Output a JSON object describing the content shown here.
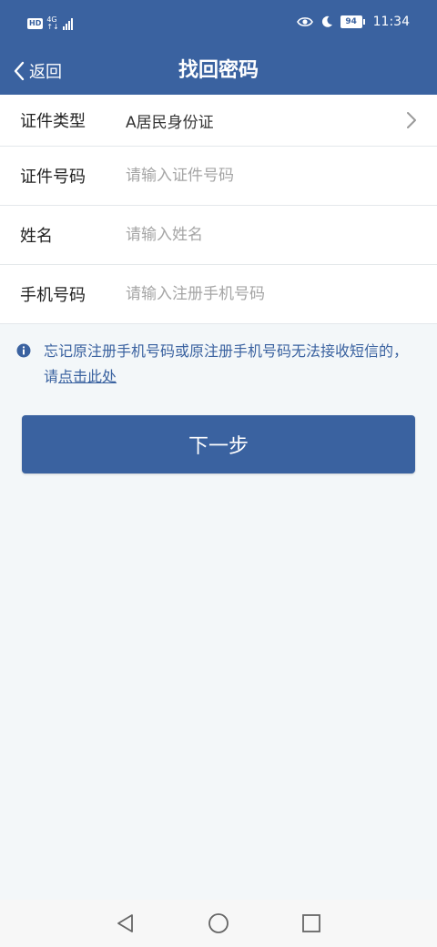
{
  "status_bar": {
    "hd_label": "HD",
    "net_label_top": "4G",
    "net_label_bottom": "↑↓",
    "battery": "94",
    "time": "11:34"
  },
  "title_bar": {
    "back_label": "返回",
    "title": "找回密码"
  },
  "form": {
    "id_type": {
      "label": "证件类型",
      "value": "A居民身份证"
    },
    "id_number": {
      "label": "证件号码",
      "placeholder": "请输入证件号码",
      "value": ""
    },
    "name": {
      "label": "姓名",
      "placeholder": "请输入姓名",
      "value": ""
    },
    "phone": {
      "label": "手机号码",
      "placeholder": "请输入注册手机号码",
      "value": ""
    }
  },
  "notice": {
    "text": "忘记原注册手机号码或原注册手机号码无法接收短信的，",
    "link_prefix": "请",
    "link_text": "点击此处"
  },
  "next_button": "下一步",
  "colors": {
    "primary": "#3a62a0",
    "background": "#f3f7f9",
    "placeholder": "#a5a5a5"
  },
  "icons": {
    "back": "chevron-left-icon",
    "id_type_arrow": "chevron-right-icon",
    "notice": "info-icon",
    "nav_back": "triangle-back-icon",
    "nav_home": "circle-home-icon",
    "nav_recent": "square-recent-icon"
  }
}
